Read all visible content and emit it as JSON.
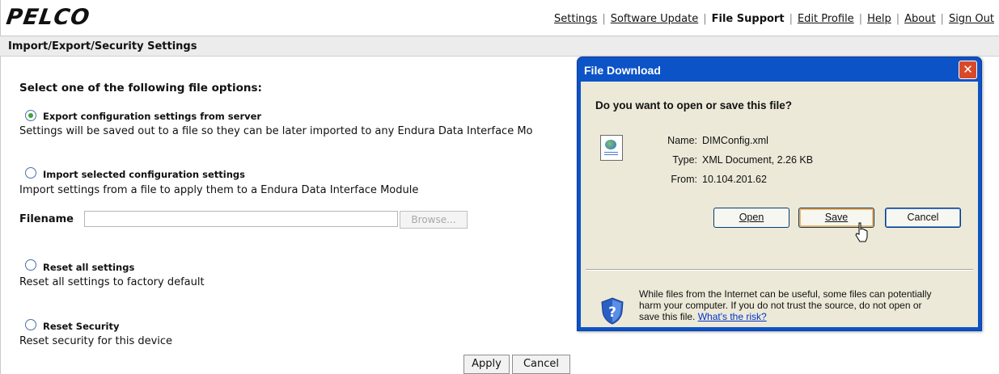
{
  "header": {
    "logo": "PELCO",
    "nav": [
      {
        "label": "Settings",
        "current": false
      },
      {
        "label": "Software Update",
        "current": false
      },
      {
        "label": "File Support",
        "current": true
      },
      {
        "label": "Edit Profile",
        "current": false
      },
      {
        "label": "Help",
        "current": false
      },
      {
        "label": "About",
        "current": false
      },
      {
        "label": "Sign Out",
        "current": false
      }
    ],
    "separator": "|"
  },
  "section_title": "Import/Export/Security Settings",
  "main": {
    "heading": "Select one of the following file options:",
    "options": [
      {
        "title": "Export configuration settings from server",
        "desc": "Settings will be saved out to a file so they can be later imported to any Endura Data Interface Mo",
        "checked": true
      },
      {
        "title": "Import selected configuration settings",
        "desc": "Import settings from a file to apply them to a Endura Data Interface Module",
        "checked": false
      },
      {
        "title": "Reset all settings",
        "desc": "Reset all settings to factory default",
        "checked": false
      },
      {
        "title": "Reset Security",
        "desc": "Reset security for this device",
        "checked": false
      }
    ],
    "filename_label": "Filename",
    "filename_value": "",
    "browse_label": "Browse...",
    "apply_label": "Apply",
    "cancel_label": "Cancel"
  },
  "dialog": {
    "title": "File Download",
    "close_label": "✕",
    "question": "Do you want to open or save this file?",
    "name_label": "Name:",
    "name_value": "DIMConfig.xml",
    "type_label": "Type:",
    "type_value": "XML Document, 2.26 KB",
    "from_label": "From:",
    "from_value": "10.104.201.62",
    "open_label": "Open",
    "save_label": "Save",
    "cancel_label": "Cancel",
    "warning_line1": "While files from the Internet can be useful, some files can potentially",
    "warning_line2": "harm your computer. If you do not trust the source, do not open or",
    "warning_line3": "save this file.",
    "risk_link": "What's the risk?"
  },
  "colors": {
    "dialog_title_bar": "#0b53c7",
    "dialog_body": "#ece9d8",
    "close_button": "#d8492a",
    "checked_radio": "#3aa53a",
    "link": "#0033cc"
  },
  "icons": [
    "file-xml-icon",
    "shield-question-icon",
    "close-icon",
    "mouse-pointer-icon"
  ]
}
